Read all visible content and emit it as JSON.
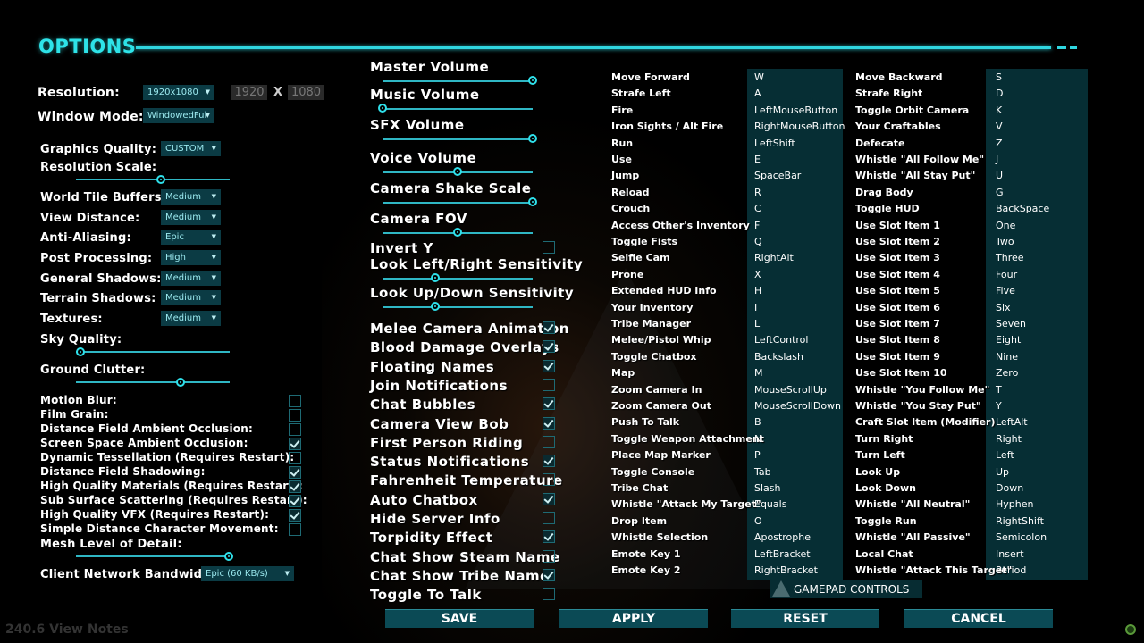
{
  "title": "OPTIONS",
  "resolution": {
    "label": "Resolution:",
    "value": "1920x1080",
    "width": "1920",
    "x": "X",
    "height": "1080"
  },
  "window_mode": {
    "label": "Window Mode:",
    "value": "WindowedFul"
  },
  "graphics": {
    "quality_label": "Graphics Quality:",
    "quality_value": "CUSTOM",
    "resolution_scale_label": "Resolution Scale:",
    "dropdowns": [
      {
        "label": "World Tile Buffers",
        "value": "Medium"
      },
      {
        "label": "View Distance:",
        "value": "Medium"
      },
      {
        "label": "Anti-Aliasing:",
        "value": "Epic"
      },
      {
        "label": "Post Processing:",
        "value": "High"
      },
      {
        "label": "General Shadows:",
        "value": "Medium"
      },
      {
        "label": "Terrain Shadows:",
        "value": "Medium"
      },
      {
        "label": "Textures:",
        "value": "Medium"
      }
    ],
    "sky_quality_label": "Sky Quality:",
    "ground_clutter_label": "Ground Clutter:",
    "toggles": [
      {
        "label": "Motion Blur:",
        "checked": false
      },
      {
        "label": "Film Grain:",
        "checked": false
      },
      {
        "label": "Distance Field Ambient Occlusion:",
        "checked": false
      },
      {
        "label": "Screen Space Ambient Occlusion:",
        "checked": true
      },
      {
        "label": "Dynamic Tessellation (Requires Restart):",
        "checked": false
      },
      {
        "label": "Distance Field Shadowing:",
        "checked": true
      },
      {
        "label": "High Quality Materials (Requires Restart):",
        "checked": true
      },
      {
        "label": "Sub Surface Scattering (Requires Restart):",
        "checked": true
      },
      {
        "label": "High Quality VFX (Requires Restart):",
        "checked": true
      },
      {
        "label": "Simple Distance Character Movement:",
        "checked": false
      }
    ],
    "mesh_lod_label": "Mesh Level of Detail:",
    "bandwidth_label": "Client Network Bandwidth:",
    "bandwidth_value": "Epic (60 KB/s)"
  },
  "audio_sliders": [
    {
      "label": "Master Volume",
      "level": 1.0
    },
    {
      "label": "Music Volume",
      "level": 0.0
    },
    {
      "label": "SFX Volume",
      "level": 1.0
    },
    {
      "label": "Voice Volume",
      "level": 0.5
    },
    {
      "label": "Camera Shake Scale",
      "level": 1.0
    },
    {
      "label": "Camera FOV",
      "level": 0.5
    }
  ],
  "invert_y": {
    "label": "Invert Y",
    "checked": false
  },
  "sensitivity": [
    {
      "label": "Look Left/Right Sensitivity",
      "level": 0.35
    },
    {
      "label": "Look Up/Down Sensitivity",
      "level": 0.35
    }
  ],
  "game_toggles": [
    {
      "label": "Melee Camera Animation",
      "checked": true
    },
    {
      "label": "Blood Damage Overlays",
      "checked": true
    },
    {
      "label": "Floating Names",
      "checked": true
    },
    {
      "label": "Join Notifications",
      "checked": false
    },
    {
      "label": "Chat Bubbles",
      "checked": true
    },
    {
      "label": "Camera View Bob",
      "checked": true
    },
    {
      "label": "First Person Riding",
      "checked": false
    },
    {
      "label": "Status Notifications",
      "checked": true
    },
    {
      "label": "Fahrenheit Temperature",
      "checked": false
    },
    {
      "label": "Auto Chatbox",
      "checked": true
    },
    {
      "label": "Hide Server Info",
      "checked": false
    },
    {
      "label": "Torpidity Effect",
      "checked": true
    },
    {
      "label": "Chat Show Steam Name",
      "checked": false
    },
    {
      "label": "Chat Show Tribe Name",
      "checked": true
    },
    {
      "label": "Toggle To Talk",
      "checked": false
    }
  ],
  "keybinds_left": [
    {
      "action": "Move Forward",
      "key": "W"
    },
    {
      "action": "Strafe Left",
      "key": "A"
    },
    {
      "action": "Fire",
      "key": "LeftMouseButton"
    },
    {
      "action": "Iron Sights / Alt Fire",
      "key": "RightMouseButton"
    },
    {
      "action": "Run",
      "key": "LeftShift"
    },
    {
      "action": "Use",
      "key": "E"
    },
    {
      "action": "Jump",
      "key": "SpaceBar"
    },
    {
      "action": "Reload",
      "key": "R"
    },
    {
      "action": "Crouch",
      "key": "C"
    },
    {
      "action": "Access Other's Inventory",
      "key": "F"
    },
    {
      "action": "Toggle Fists",
      "key": "Q"
    },
    {
      "action": "Selfie Cam",
      "key": "RightAlt"
    },
    {
      "action": "Prone",
      "key": "X"
    },
    {
      "action": "Extended HUD Info",
      "key": "H"
    },
    {
      "action": "Your Inventory",
      "key": "I"
    },
    {
      "action": "Tribe Manager",
      "key": "L"
    },
    {
      "action": "Melee/Pistol Whip",
      "key": "LeftControl"
    },
    {
      "action": "Toggle Chatbox",
      "key": "Backslash"
    },
    {
      "action": "Map",
      "key": "M"
    },
    {
      "action": "Zoom Camera In",
      "key": "MouseScrollUp"
    },
    {
      "action": "Zoom Camera Out",
      "key": "MouseScrollDown"
    },
    {
      "action": "Push To Talk",
      "key": "B"
    },
    {
      "action": "Toggle Weapon Attachment",
      "key": "N"
    },
    {
      "action": "Place Map Marker",
      "key": "P"
    },
    {
      "action": "Toggle Console",
      "key": "Tab"
    },
    {
      "action": "Tribe Chat",
      "key": "Slash"
    },
    {
      "action": "Whistle \"Attack My Target\"",
      "key": "Equals"
    },
    {
      "action": "Drop Item",
      "key": "O"
    },
    {
      "action": "Whistle Selection",
      "key": "Apostrophe"
    },
    {
      "action": "Emote Key 1",
      "key": "LeftBracket"
    },
    {
      "action": "Emote Key 2",
      "key": "RightBracket"
    }
  ],
  "keybinds_right": [
    {
      "action": "Move Backward",
      "key": "S"
    },
    {
      "action": "Strafe Right",
      "key": "D"
    },
    {
      "action": "Toggle Orbit Camera",
      "key": "K"
    },
    {
      "action": "Your Craftables",
      "key": "V"
    },
    {
      "action": "Defecate",
      "key": "Z"
    },
    {
      "action": "Whistle \"All Follow Me\"",
      "key": "J"
    },
    {
      "action": "Whistle \"All Stay Put\"",
      "key": "U"
    },
    {
      "action": "Drag Body",
      "key": "G"
    },
    {
      "action": "Toggle HUD",
      "key": "BackSpace"
    },
    {
      "action": "Use Slot Item 1",
      "key": "One"
    },
    {
      "action": "Use Slot Item 2",
      "key": "Two"
    },
    {
      "action": "Use Slot Item 3",
      "key": "Three"
    },
    {
      "action": "Use Slot Item 4",
      "key": "Four"
    },
    {
      "action": "Use Slot Item 5",
      "key": "Five"
    },
    {
      "action": "Use Slot Item 6",
      "key": "Six"
    },
    {
      "action": "Use Slot Item 7",
      "key": "Seven"
    },
    {
      "action": "Use Slot Item 8",
      "key": "Eight"
    },
    {
      "action": "Use Slot Item 9",
      "key": "Nine"
    },
    {
      "action": "Use Slot Item 10",
      "key": "Zero"
    },
    {
      "action": "Whistle \"You Follow Me\"",
      "key": "T"
    },
    {
      "action": "Whistle \"You Stay Put\"",
      "key": "Y"
    },
    {
      "action": "Craft Slot Item (Modifier)",
      "key": "LeftAlt"
    },
    {
      "action": "Turn Right",
      "key": "Right"
    },
    {
      "action": "Turn Left",
      "key": "Left"
    },
    {
      "action": "Look Up",
      "key": "Up"
    },
    {
      "action": "Look Down",
      "key": "Down"
    },
    {
      "action": "Whistle \"All Neutral\"",
      "key": "Hyphen"
    },
    {
      "action": "Toggle Run",
      "key": "RightShift"
    },
    {
      "action": "Whistle \"All Passive\"",
      "key": "Semicolon"
    },
    {
      "action": "Local Chat",
      "key": "Insert"
    },
    {
      "action": "Whistle \"Attack This Target\"",
      "key": "Period"
    }
  ],
  "gamepad_label": "GAMEPAD CONTROLS",
  "buttons": {
    "save": "SAVE",
    "apply": "APPLY",
    "reset": "RESET",
    "cancel": "CANCEL"
  },
  "watermark": "240.6 View Notes",
  "colors": {
    "accent": "#2ee3e8",
    "button_bg": "#0b4a55",
    "dropdown_bg": "#0b3b44",
    "key_col_bg": "#062e34"
  }
}
